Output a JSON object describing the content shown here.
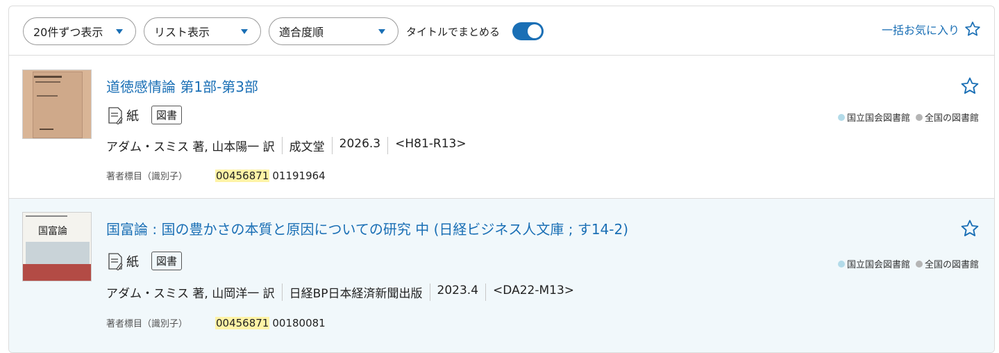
{
  "toolbar": {
    "per_page": "20件ずつ表示",
    "view_mode": "リスト表示",
    "sort": "適合度順",
    "group_by_title_label": "タイトルでまとめる",
    "group_by_title_on": true,
    "bulk_favorite": "一括お気に入り"
  },
  "results": [
    {
      "title": "道徳感情論 第1部-第3部",
      "format_label": "紙",
      "type_badge": "図書",
      "meta": [
        "アダム・スミス 著, 山本陽一 訳",
        "成文堂",
        "2026.3",
        "<H81-R13>"
      ],
      "ident_label": "著者標目（識別子）",
      "ident_highlight": "00456871",
      "ident_other": "01191964",
      "holding_ndl": "国立国会図書館",
      "holding_all": "全国の図書館"
    },
    {
      "title": "国富論 : 国の豊かさの本質と原因についての研究 中 (日経ビジネス人文庫 ; す14-2)",
      "format_label": "紙",
      "type_badge": "図書",
      "meta": [
        "アダム・スミス 著, 山岡洋一 訳",
        "日経BP日本経済新聞出版",
        "2023.4",
        "<DA22-M13>"
      ],
      "ident_label": "著者標目（識別子）",
      "ident_highlight": "00456871",
      "ident_other": "00180081",
      "holding_ndl": "国立国会図書館",
      "holding_all": "全国の図書館",
      "cover_text": "国富論"
    }
  ],
  "colors": {
    "accent": "#1a6fb5",
    "highlight": "#fff3a6",
    "row_alt": "#f1f8fb"
  },
  "icons": [
    "caret-down-icon",
    "star-outline-icon",
    "paper-document-icon"
  ]
}
